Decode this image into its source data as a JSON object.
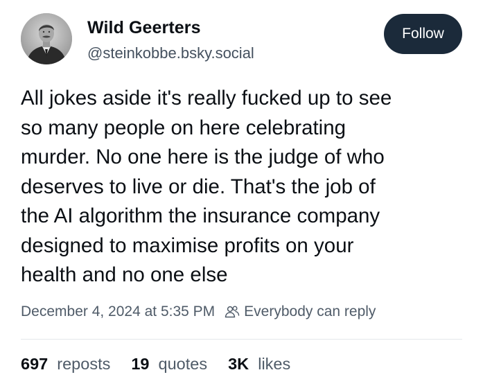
{
  "author": {
    "display_name": "Wild Geerters",
    "handle": "@steinkobbe.bsky.social",
    "avatar_icon": "portrait-photo"
  },
  "follow_button": {
    "label": "Follow",
    "color": "#1b2a3a"
  },
  "post": {
    "lines": [
      "All jokes aside it's really fucked up to see",
      "so many people on here celebrating",
      "murder. No one here is the judge of who",
      "deserves to live or die. That's the job of",
      "the AI algorithm the insurance company",
      "designed to maximise profits on your",
      "health and no one else"
    ]
  },
  "meta": {
    "timestamp": "December 4, 2024 at 5:35 PM",
    "reply_setting": "Everybody can reply",
    "reply_icon": "people-icon"
  },
  "stats": {
    "reposts_count": "697",
    "reposts_label": "reposts",
    "quotes_count": "19",
    "quotes_label": "quotes",
    "likes_count": "3K",
    "likes_label": "likes"
  }
}
